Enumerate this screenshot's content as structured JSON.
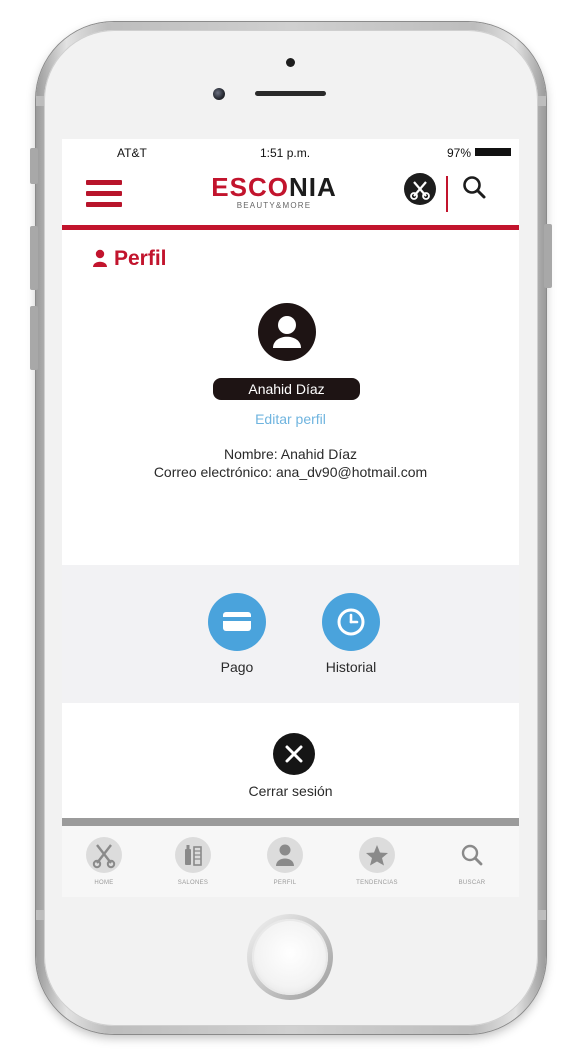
{
  "status_bar": {
    "carrier": "AT&T",
    "time": "1:51 p.m.",
    "battery": "97%"
  },
  "header": {
    "logo_part1": "ESCO",
    "logo_part2": "NIA",
    "logo_sub": "BEAUTY&MORE",
    "menu_icon": "hamburger-menu-icon",
    "tools_icon": "scissors-comb-icon",
    "search_icon": "search-icon"
  },
  "profile": {
    "section_title": "Perfil",
    "user_name": "Anahid Díaz",
    "edit_link": "Editar perfil",
    "name_line": "Nombre: Anahid Díaz",
    "email_line": "Correo electrónico: ana_dv90@hotmail.com"
  },
  "actions": [
    {
      "label": "Pago",
      "icon": "credit-card-icon"
    },
    {
      "label": "Historial",
      "icon": "clock-icon"
    }
  ],
  "logout": {
    "label": "Cerrar sesión",
    "icon": "close-icon"
  },
  "tabbar": [
    {
      "label": "HOME",
      "icon": "scissors-icon"
    },
    {
      "label": "SALONES",
      "icon": "salon-tools-icon"
    },
    {
      "label": "PERFIL",
      "icon": "person-icon"
    },
    {
      "label": "TENDENCIAS",
      "icon": "star-icon"
    },
    {
      "label": "BUSCAR",
      "icon": "search-icon"
    }
  ],
  "colors": {
    "brand_red": "#c2142d",
    "action_blue": "#4aa3dc",
    "link_blue": "#6fb4df",
    "dark": "#1e1414"
  }
}
